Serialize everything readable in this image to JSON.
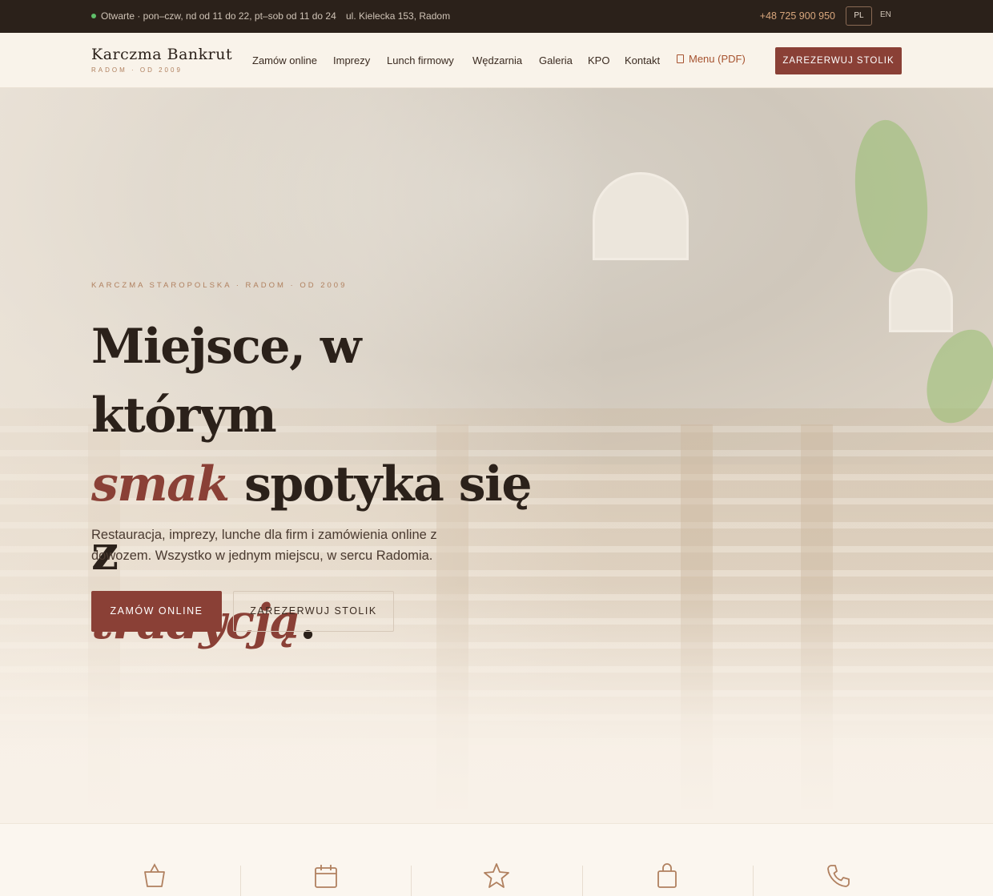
{
  "topbar": {
    "hours": "Otwarte · pon–czw, nd od 11 do 22, pt–sob od 11 do 24",
    "address": "ul. Kielecka 153, Radom",
    "phone": "+48 725 900 950",
    "lang_pl": "PL",
    "lang_en": "EN",
    "status_color": "#5fbf6a"
  },
  "brand": {
    "name": "Karczma Bankrut",
    "tagline": "RADOM · OD 2009"
  },
  "nav": {
    "items": [
      "Zamów online",
      "Imprezy",
      "Lunch firmowy",
      "Wędzarnia",
      "Galeria",
      "KPO",
      "Kontakt"
    ],
    "menu_pdf": "Menu (PDF)",
    "reserve_label": "ZAREZERWUJ STOLIK"
  },
  "hero": {
    "eyebrow": "KARCZMA STAROPOLSKA · RADOM · OD 2009",
    "headline_1": "Miejsce, w którym",
    "headline_accent_1": "smak",
    "headline_2": " spotyka się z",
    "headline_accent_2": "tradycją",
    "headline_end": ".",
    "lead": "Restauracja, imprezy, lunche dla firm i zamówienia online z dowozem. Wszystko w jednym miejscu, w sercu Radomia.",
    "order_label": "ZAMÓW ONLINE",
    "reserve_label": "ZAREZERWUJ STOLIK"
  },
  "features": {
    "icons": [
      "shopping-basket-icon",
      "calendar-icon",
      "star-icon",
      "shopping-bag-icon",
      "phone-icon"
    ]
  },
  "colors": {
    "accent": "#8a4036",
    "topbar_bg": "#2b211a",
    "cream": "#f8f1e8",
    "gold": "#b0805f"
  }
}
